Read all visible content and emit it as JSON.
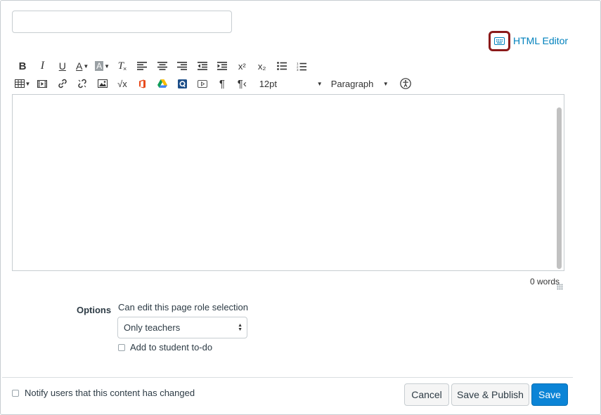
{
  "title_input": {
    "value": "",
    "placeholder": ""
  },
  "html_editor": {
    "label": "HTML Editor",
    "icon": "keyboard-icon",
    "highlight_color": "#8b1a1a",
    "link_color": "#0081bd"
  },
  "toolbar": {
    "bold": "B",
    "italic": "I",
    "underline": "U",
    "text_color": "A",
    "background_color": "A",
    "clear_formatting": "T",
    "superscript": "x²",
    "subscript": "x₂",
    "font_size": "12pt",
    "paragraph": "Paragraph"
  },
  "editor": {
    "content": "",
    "word_count": "0 words"
  },
  "options": {
    "label": "Options",
    "role_label": "Can edit this page role selection",
    "role_selected": "Only teachers",
    "todo_label": "Add to student to-do",
    "todo_checked": false
  },
  "footer": {
    "notify_label": "Notify users that this content has changed",
    "notify_checked": false,
    "cancel": "Cancel",
    "save_publish": "Save & Publish",
    "save": "Save",
    "save_color": "#0b84d6"
  }
}
